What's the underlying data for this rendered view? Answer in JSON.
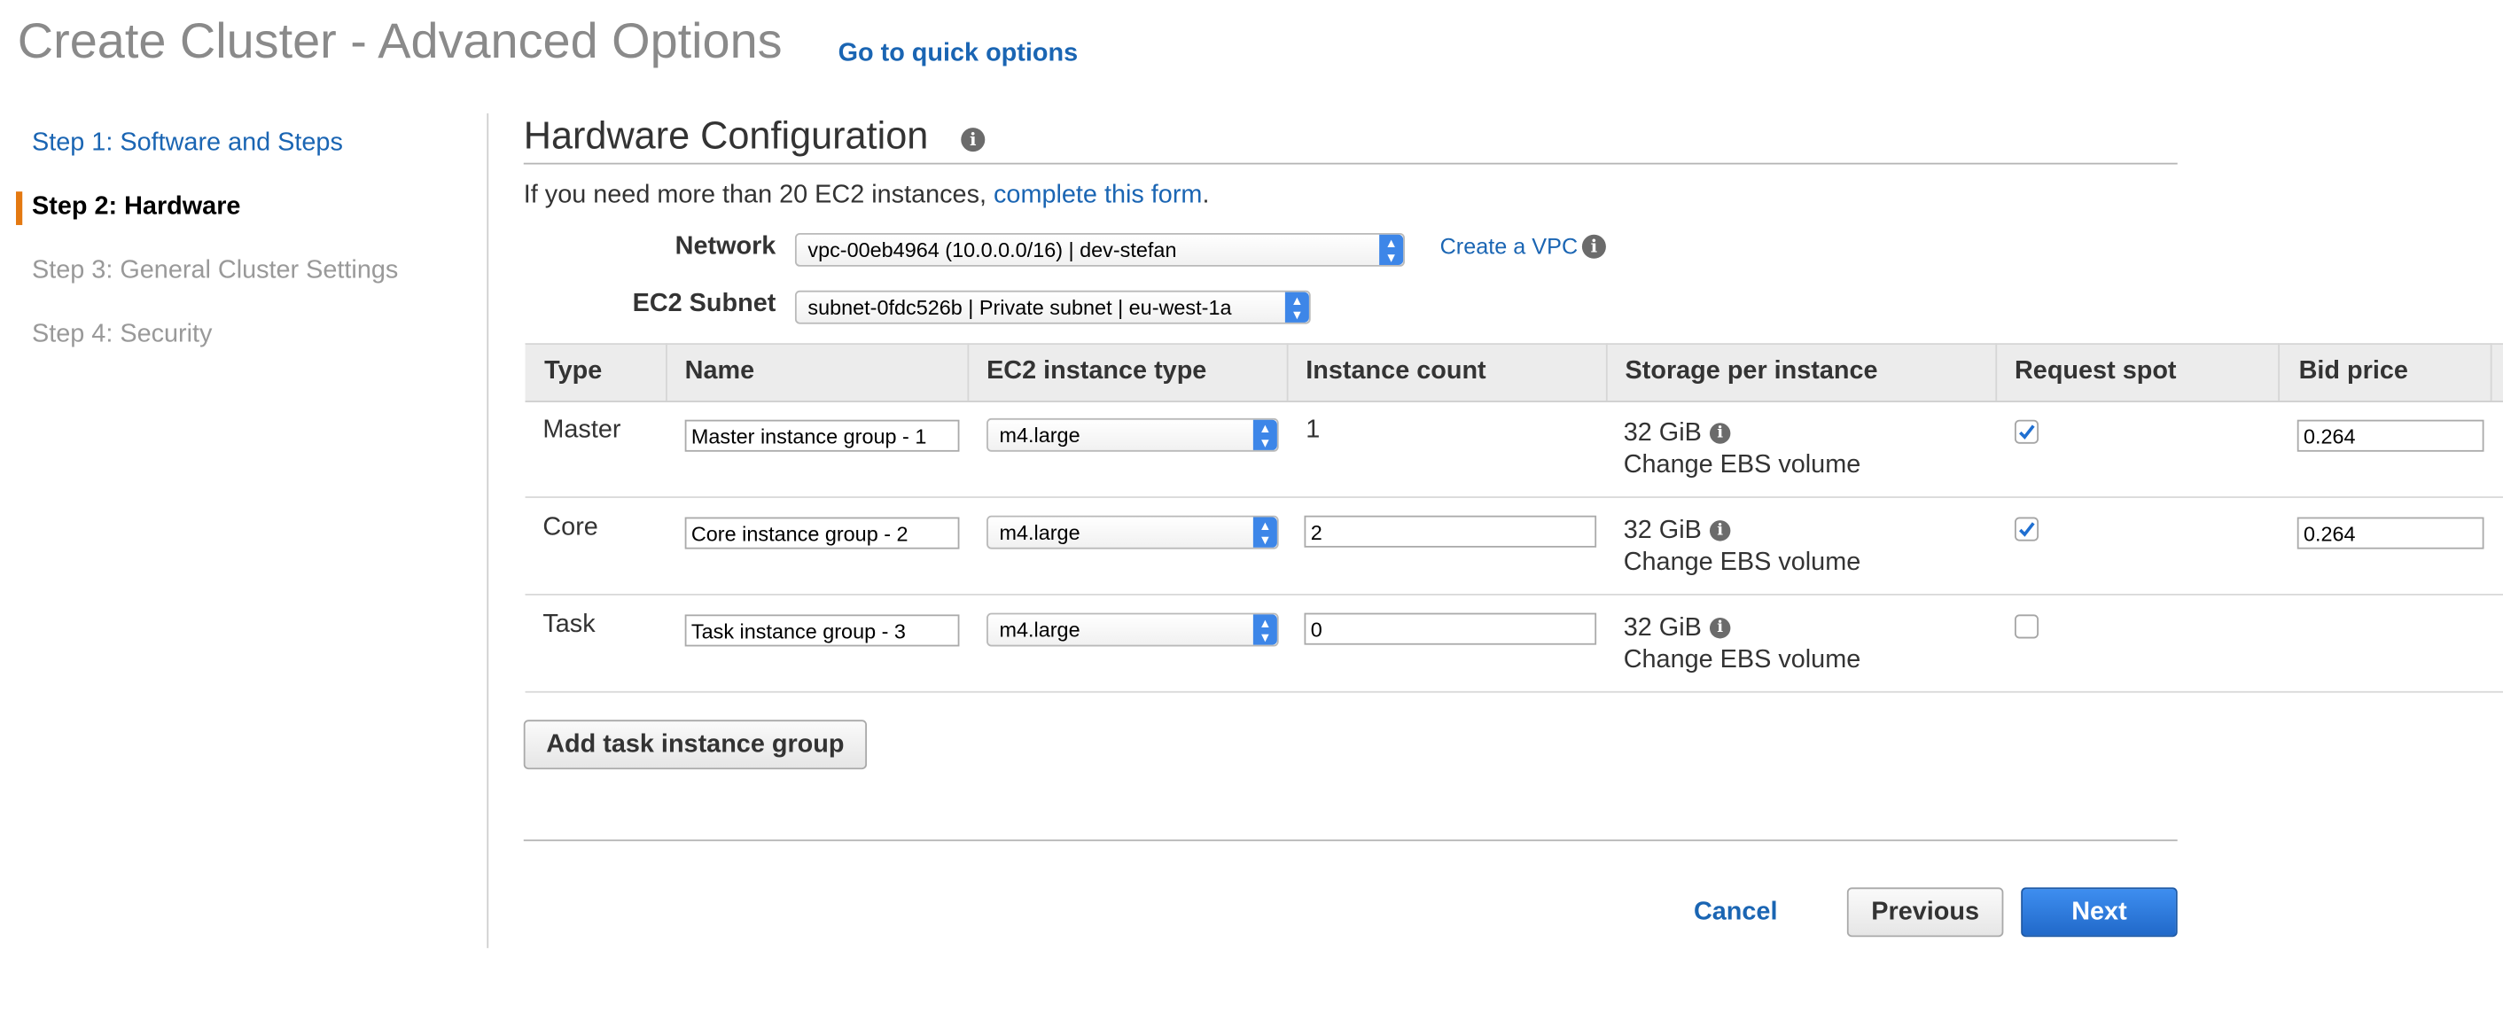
{
  "header": {
    "title": "Create Cluster - Advanced Options",
    "quick_link": "Go to quick options"
  },
  "steps": [
    {
      "label": "Step 1: Software and Steps",
      "state": "link"
    },
    {
      "label": "Step 2: Hardware",
      "state": "current"
    },
    {
      "label": "Step 3: General Cluster Settings",
      "state": "disabled"
    },
    {
      "label": "Step 4: Security",
      "state": "disabled"
    }
  ],
  "section": {
    "title": "Hardware Configuration",
    "notice_prefix": "If you need more than 20 EC2 instances, ",
    "notice_link": "complete this form",
    "notice_suffix": "."
  },
  "network": {
    "label": "Network",
    "value": "vpc-00eb4964 (10.0.0.0/16) | dev-stefan",
    "create_link": "Create a VPC"
  },
  "subnet": {
    "label": "EC2 Subnet",
    "value": "subnet-0fdc526b | Private subnet | eu-west-1a"
  },
  "table": {
    "headers": [
      "Type",
      "Name",
      "EC2 instance type",
      "Instance count",
      "Storage per instance",
      "Request spot",
      "Bid price"
    ],
    "rows": [
      {
        "type": "Master",
        "name": "Master instance group - 1",
        "instance_type": "m4.large",
        "count": "1",
        "storage": "32 GiB",
        "ebs_link": "Change EBS volume",
        "spot": true,
        "bid": "0.264"
      },
      {
        "type": "Core",
        "name": "Core instance group - 2",
        "instance_type": "m4.large",
        "count": "2",
        "storage": "32 GiB",
        "ebs_link": "Change EBS volume",
        "spot": true,
        "bid": "0.264"
      },
      {
        "type": "Task",
        "name": "Task instance group - 3",
        "instance_type": "m4.large",
        "count": "0",
        "storage": "32 GiB",
        "ebs_link": "Change EBS volume",
        "spot": false,
        "bid": ""
      }
    ]
  },
  "buttons": {
    "add_task": "Add task instance group",
    "cancel": "Cancel",
    "previous": "Previous",
    "next": "Next"
  },
  "colors": {
    "link": "#1a65b3",
    "accent_marker": "#e47911",
    "primary_button": "#2d7ddc",
    "select_arrow": "#3d86e8"
  },
  "icons": {
    "info": "info-icon",
    "select_arrows": "updown-chevron-icon",
    "checkmark": "checkmark-icon"
  }
}
